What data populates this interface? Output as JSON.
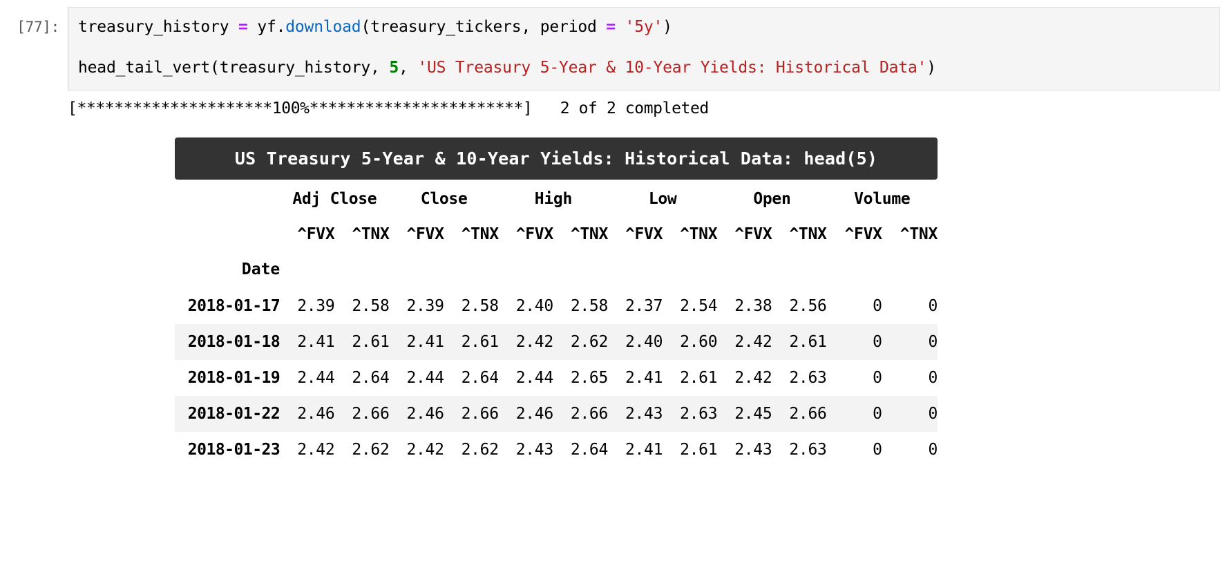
{
  "cell": {
    "prompt": "[77]:",
    "code_lines": [
      [
        {
          "t": "plain",
          "v": "treasury_history "
        },
        {
          "t": "op",
          "v": "="
        },
        {
          "t": "plain",
          "v": " yf."
        },
        {
          "t": "fn",
          "v": "download"
        },
        {
          "t": "plain",
          "v": "(treasury_tickers, period "
        },
        {
          "t": "op",
          "v": "="
        },
        {
          "t": "plain",
          "v": " "
        },
        {
          "t": "str",
          "v": "'5y'"
        },
        {
          "t": "plain",
          "v": ")"
        }
      ],
      [],
      [
        {
          "t": "plain",
          "v": "head_tail_vert(treasury_history, "
        },
        {
          "t": "num",
          "v": "5"
        },
        {
          "t": "plain",
          "v": ", "
        },
        {
          "t": "str",
          "v": "'US Treasury 5-Year & 10-Year Yields: Historical Data'"
        },
        {
          "t": "plain",
          "v": ")"
        }
      ]
    ]
  },
  "stdout": {
    "progress": "[*********************100%***********************]",
    "status": "2 of 2 completed"
  },
  "dataframe": {
    "title": "US Treasury 5-Year & 10-Year Yields: Historical Data: head(5)",
    "index_name": "Date",
    "column_groups": [
      "Adj Close",
      "Close",
      "High",
      "Low",
      "Open",
      "Volume"
    ],
    "tickers": [
      "^FVX",
      "^TNX",
      "^FVX",
      "^TNX",
      "^FVX",
      "^TNX",
      "^FVX",
      "^TNX",
      "^FVX",
      "^TNX",
      "^FVX",
      "^TNX"
    ],
    "rows": [
      {
        "date": "2018-01-17",
        "values": [
          "2.39",
          "2.58",
          "2.39",
          "2.58",
          "2.40",
          "2.58",
          "2.37",
          "2.54",
          "2.38",
          "2.56",
          "0",
          "0"
        ]
      },
      {
        "date": "2018-01-18",
        "values": [
          "2.41",
          "2.61",
          "2.41",
          "2.61",
          "2.42",
          "2.62",
          "2.40",
          "2.60",
          "2.42",
          "2.61",
          "0",
          "0"
        ]
      },
      {
        "date": "2018-01-19",
        "values": [
          "2.44",
          "2.64",
          "2.44",
          "2.64",
          "2.44",
          "2.65",
          "2.41",
          "2.61",
          "2.42",
          "2.63",
          "0",
          "0"
        ]
      },
      {
        "date": "2018-01-22",
        "values": [
          "2.46",
          "2.66",
          "2.46",
          "2.66",
          "2.46",
          "2.66",
          "2.43",
          "2.63",
          "2.45",
          "2.66",
          "0",
          "0"
        ]
      },
      {
        "date": "2018-01-23",
        "values": [
          "2.42",
          "2.62",
          "2.42",
          "2.62",
          "2.43",
          "2.64",
          "2.41",
          "2.61",
          "2.43",
          "2.63",
          "0",
          "0"
        ]
      }
    ]
  },
  "colors": {
    "title_bg": "#333333",
    "code_bg": "#f5f5f5",
    "string": "#ba2121",
    "function": "#0d66c2",
    "operator": "#aa22ff",
    "number": "#008000",
    "stripe": "#f3f3f3"
  }
}
